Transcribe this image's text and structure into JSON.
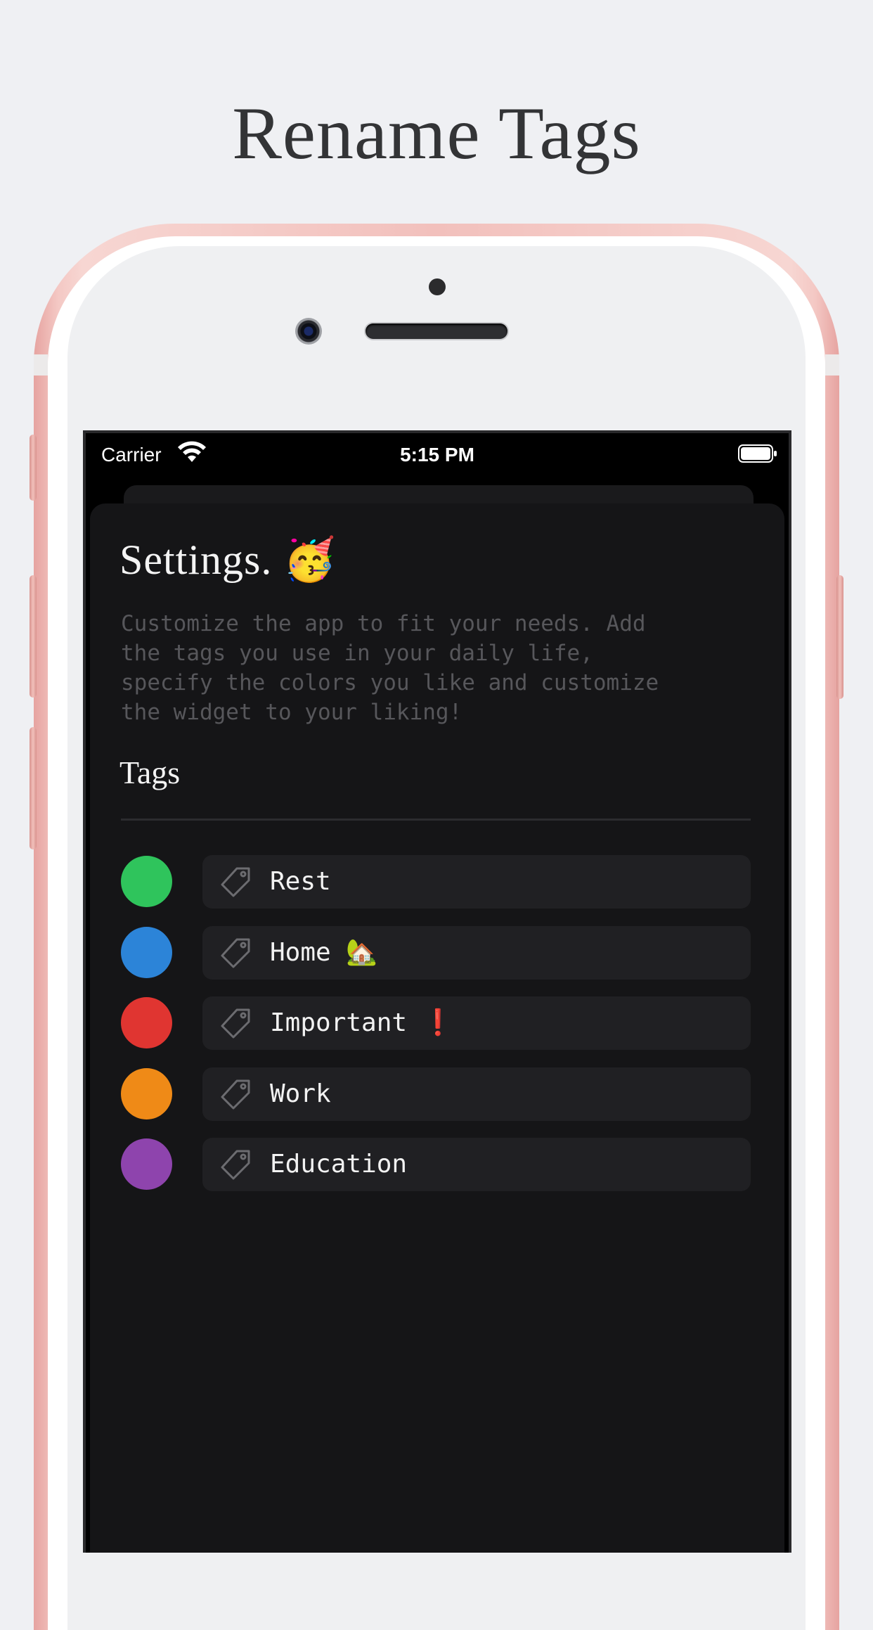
{
  "headline": "Rename Tags",
  "status_bar": {
    "carrier": "Carrier",
    "time": "5:15 PM"
  },
  "settings": {
    "title": "Settings. 🥳",
    "description": "Customize the app to fit your needs. Add\nthe tags you use in your daily life,\nspecify the colors you like and customize\nthe widget to your liking!",
    "tags_heading": "Tags"
  },
  "tags": [
    {
      "label": "Rest",
      "color": "#2fc45c"
    },
    {
      "label": "Home 🏡",
      "color": "#2c84d8"
    },
    {
      "label": "Important ❗",
      "color": "#e03531"
    },
    {
      "label": "Work",
      "color": "#ef8a17"
    },
    {
      "label": "Education",
      "color": "#8e44ad"
    }
  ],
  "icons": {
    "wifi": "wifi-icon",
    "battery": "battery-icon",
    "tag": "tag-icon"
  }
}
